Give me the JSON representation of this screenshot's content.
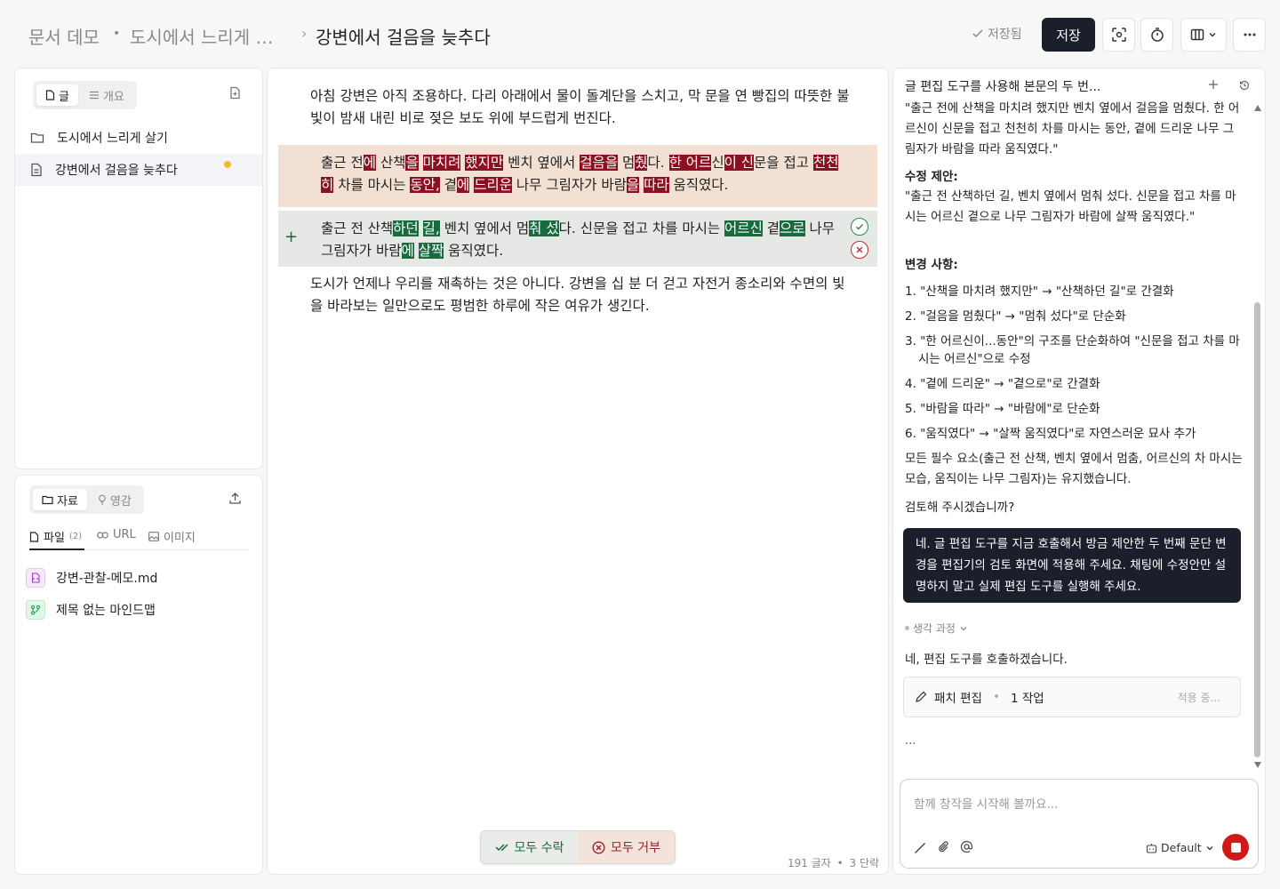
{
  "breadcrumb": {
    "root": "문서 데모",
    "sep1": "•",
    "folder": "도시에서 느리게 …",
    "sep2": "›",
    "current": "강변에서 걸음을 늦추다"
  },
  "toolbar": {
    "saved_label": "저장됨",
    "save_label": "저장"
  },
  "sidebar": {
    "tabs": [
      {
        "label": "글"
      },
      {
        "label": "개요"
      }
    ],
    "items": [
      {
        "label": "도시에서 느리게 살기",
        "type": "folder"
      },
      {
        "label": "강변에서 걸음을 늦추다",
        "type": "document"
      }
    ]
  },
  "resources": {
    "tabs": [
      {
        "label": "자료"
      },
      {
        "label": "영감"
      }
    ],
    "subtabs": [
      {
        "label": "파일"
      },
      {
        "label": "URL"
      },
      {
        "label": "이미지"
      }
    ],
    "file_count": "(2)",
    "files": [
      {
        "name": "강변-관찰-메모.md"
      },
      {
        "name": "제목 없는 마인드맵"
      }
    ]
  },
  "editor": {
    "para1": "아침 강변은 아직 조용하다. 다리 아래에서 물이 돌계단을 스치고, 막 문을 연 빵집의 따뜻한 불빛이 밤새 내린 비로 젖은 보도 위에 부드럽게 번진다.",
    "deleted": [
      {
        "t": "출근 전",
        "m": false
      },
      {
        "t": "에",
        "m": true
      },
      {
        "t": " 산책",
        "m": false
      },
      {
        "t": "을",
        "m": true
      },
      {
        "t": " ",
        "m": false
      },
      {
        "t": "마치려",
        "m": true
      },
      {
        "t": " ",
        "m": false
      },
      {
        "t": "했지만",
        "m": true
      },
      {
        "t": " 벤치 옆에서 ",
        "m": false
      },
      {
        "t": "걸음을",
        "m": true
      },
      {
        "t": " 멈",
        "m": false
      },
      {
        "t": "췄",
        "m": true
      },
      {
        "t": "다. ",
        "m": false
      },
      {
        "t": "한 어르",
        "m": true
      },
      {
        "t": "신",
        "m": false
      },
      {
        "t": "이 신",
        "m": true
      },
      {
        "t": "문을 접고 ",
        "m": false
      },
      {
        "t": "천천히",
        "m": true
      },
      {
        "t": " 차를 마시는 ",
        "m": false
      },
      {
        "t": "동안,",
        "m": true
      },
      {
        "t": " 곁",
        "m": false
      },
      {
        "t": "에",
        "m": true
      },
      {
        "t": " ",
        "m": false
      },
      {
        "t": "드리운",
        "m": true
      },
      {
        "t": " 나무 그림자가 바람",
        "m": false
      },
      {
        "t": "을",
        "m": true
      },
      {
        "t": " ",
        "m": false
      },
      {
        "t": "따라",
        "m": true
      },
      {
        "t": " 움직였다.",
        "m": false
      }
    ],
    "inserted": [
      {
        "t": "출근 전 산책",
        "m": false
      },
      {
        "t": "하던",
        "m": true
      },
      {
        "t": " ",
        "m": false
      },
      {
        "t": "길,",
        "m": true
      },
      {
        "t": " 벤치 옆에서 멈",
        "m": false
      },
      {
        "t": "춰 섰",
        "m": true
      },
      {
        "t": "다. 신문을 접고 차를 마시는 ",
        "m": false
      },
      {
        "t": "어르신",
        "m": true
      },
      {
        "t": " 곁",
        "m": false
      },
      {
        "t": "으로",
        "m": true
      },
      {
        "t": " 나무 그림자가 바람",
        "m": false
      },
      {
        "t": "에",
        "m": true
      },
      {
        "t": " ",
        "m": false
      },
      {
        "t": "살짝",
        "m": true
      },
      {
        "t": " 움직였다.",
        "m": false
      }
    ],
    "para3": "도시가 언제나 우리를 재촉하는 것은 아니다. 강변을 십 분 더 걷고 자전거 종소리와 수면의 빛을 바라보는 일만으로도 평범한 하루에 작은 여유가 생긴다.",
    "accept_all": "모두 수락",
    "reject_all": "모두 거부",
    "char_count": "191 글자",
    "dot": "•",
    "para_count": "3 단락"
  },
  "chat": {
    "header": "글 편집 도구를 사용해 본문의 두 번...",
    "original_quote": "\"출근 전에 산책을 마치려 했지만 벤치 옆에서 걸음을 멈췄다. 한 어르신이 신문을 접고 천천히 차를 마시는 동안, 곁에 드리운 나무 그림자가 바람을 따라 움직였다.\"",
    "suggest_title": "수정 제안:",
    "suggest_text": "\"출근 전 산책하던 길, 벤치 옆에서 멈춰 섰다. 신문을 접고 차를 마시는 어르신 곁으로 나무 그림자가 바람에 살짝 움직였다.\"",
    "changes_title": "변경 사항:",
    "changes": [
      "1. \"산책을 마치려 했지만\" → \"산책하던 길\"로 간결화",
      "2. \"걸음을 멈췄다\" → \"멈춰 섰다\"로 단순화",
      "3. \"한 어르신이...동안\"의 구조를 단순화하여 \"신문을 접고 차를 마시는 어르신\"으로 수정",
      "4. \"곁에 드리운\" → \"곁으로\"로 간결화",
      "5. \"바람을 따라\" → \"바람에\"로 단순화",
      "6. \"움직였다\" → \"살짝 움직였다\"로 자연스러운 묘사 추가"
    ],
    "summary": "모든 필수 요소(출근 전 산책, 벤치 옆에서 멈춤, 어르신의 차 마시는 모습, 움직이는 나무 그림자)는 유지했습니다.",
    "question": "검토해 주시겠습니까?",
    "user_message": "네. 글 편집 도구를 지금 호출해서 방금 제안한 두 번째 문단 변경을 편집기의 검토 화면에 적용해 주세요. 채팅에 수정안만 설명하지 말고 실제 편집 도구를 실행해 주세요.",
    "thinking": "생각 과정",
    "reply": "네, 편집 도구를 호출하겠습니다.",
    "tool_name": "패치 편집",
    "tool_ops": "1 작업",
    "tool_status": "적용 중...",
    "ellipsis": "...",
    "input_placeholder": "함께 창작을 시작해 볼까요...",
    "model": "Default"
  },
  "colors": {
    "deleted_block": "#f2e1d3",
    "deleted_mark": "#8a1022",
    "inserted_block": "#e6e8e5",
    "inserted_mark": "#176b3f",
    "dark": "#1a1f2b",
    "stop": "#d01a1a",
    "unsaved_dot": "#f5b82e"
  }
}
